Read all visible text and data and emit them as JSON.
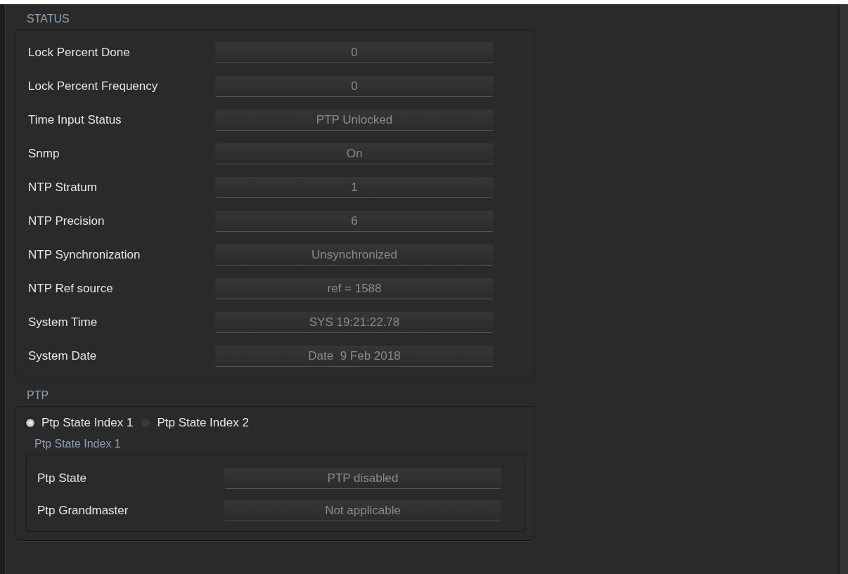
{
  "status": {
    "title": "STATUS",
    "rows": [
      {
        "label": "Lock Percent Done",
        "value": "0"
      },
      {
        "label": "Lock Percent Frequency",
        "value": "0"
      },
      {
        "label": "Time Input Status",
        "value": "PTP Unlocked"
      },
      {
        "label": "Snmp",
        "value": "On"
      },
      {
        "label": "NTP Stratum",
        "value": "1"
      },
      {
        "label": "NTP Precision",
        "value": "6"
      },
      {
        "label": "NTP Synchronization",
        "value": "Unsynchronized"
      },
      {
        "label": "NTP Ref source",
        "value": "ref = 1588"
      },
      {
        "label": "System Time",
        "value": "SYS 19:21:22.78"
      },
      {
        "label": "System Date",
        "value": "Date  9 Feb 2018"
      }
    ]
  },
  "ptp": {
    "title": "PTP",
    "options": [
      {
        "label": "Ptp State Index 1",
        "selected": true
      },
      {
        "label": "Ptp State Index 2",
        "selected": false
      }
    ],
    "subsection": {
      "title": "Ptp State Index 1",
      "rows": [
        {
          "label": "Ptp State",
          "value": "PTP disabled"
        },
        {
          "label": "Ptp Grandmaster",
          "value": "Not applicable"
        }
      ]
    }
  }
}
